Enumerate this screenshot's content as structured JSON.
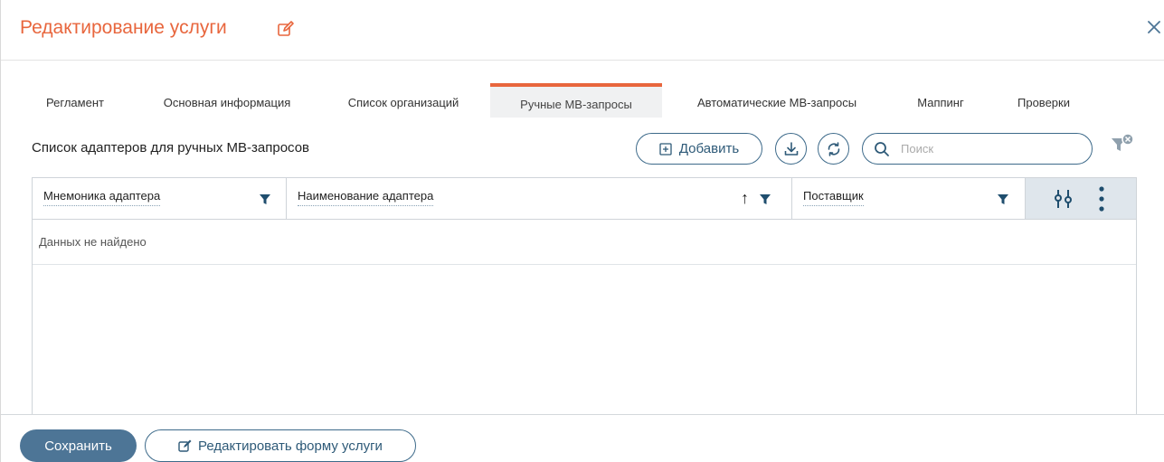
{
  "header": {
    "title": "Редактирование услуги",
    "edit_icon": "edit-pencil-icon",
    "close_icon": "close-icon"
  },
  "tabs": [
    {
      "label": "Регламент",
      "active": false
    },
    {
      "label": "Основная информация",
      "active": false
    },
    {
      "label": "Список организаций",
      "active": false
    },
    {
      "label": "Ручные МВ-запросы",
      "active": true
    },
    {
      "label": "Автоматические МВ-запросы",
      "active": false
    },
    {
      "label": "Маппинг",
      "active": false
    },
    {
      "label": "Проверки",
      "active": false
    }
  ],
  "toolbar": {
    "section_title": "Список адаптеров для ручных МВ-запросов",
    "add_label": "Добавить",
    "search_placeholder": "Поиск"
  },
  "grid": {
    "columns": [
      {
        "label": "Мнемоника адаптера"
      },
      {
        "label": "Наименование адаптера",
        "sort": "↑"
      },
      {
        "label": "Поставщик"
      }
    ],
    "empty_text": "Данных не найдено"
  },
  "footer": {
    "save_label": "Сохранить",
    "edit_form_label": "Редактировать форму услуги"
  },
  "colors": {
    "accent": "#e8663d",
    "primary": "#4d7596",
    "outline": "#3d6a8a",
    "header_tools_bg": "#dfe6ec"
  }
}
